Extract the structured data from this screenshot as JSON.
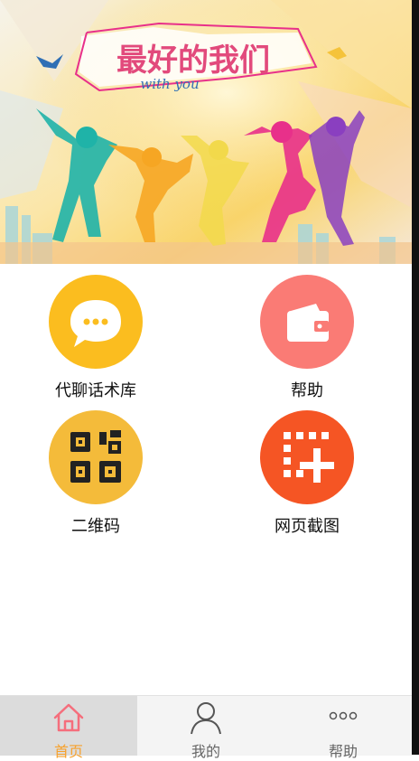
{
  "banner": {
    "title": "最好的我们",
    "subtitle": "with you"
  },
  "menu": [
    {
      "label": "代聊话术库",
      "icon": "chat-bubble-icon",
      "color": "#fbbd1f"
    },
    {
      "label": "帮助",
      "icon": "wallet-icon",
      "color": "#fa7b75"
    },
    {
      "label": "二维码",
      "icon": "qr-code-icon",
      "color": "#f4bb3a"
    },
    {
      "label": "网页截图",
      "icon": "screenshot-add-icon",
      "color": "#f55524"
    }
  ],
  "tabs": [
    {
      "label": "首页",
      "icon": "home-icon",
      "active": true
    },
    {
      "label": "我的",
      "icon": "user-icon",
      "active": false
    },
    {
      "label": "帮助",
      "icon": "more-dots-icon",
      "active": false
    }
  ],
  "colors": {
    "accent": "#f7a12b",
    "home_icon": "#f56e7c"
  }
}
